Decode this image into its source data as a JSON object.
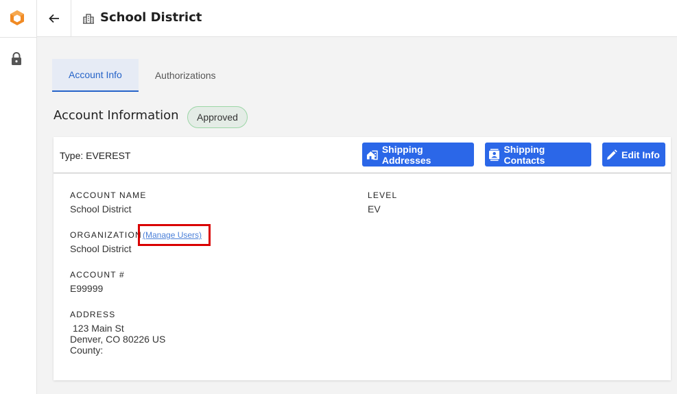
{
  "header": {
    "title": "School District"
  },
  "tabs": [
    {
      "label": "Account Info",
      "active": true
    },
    {
      "label": "Authorizations",
      "active": false
    }
  ],
  "section": {
    "title": "Account Information",
    "status": "Approved"
  },
  "card": {
    "type_label": "Type: EVEREST",
    "buttons": {
      "shipping_addresses": "Shipping Addresses",
      "shipping_contacts": "Shipping Contacts",
      "edit_info": "Edit Info"
    },
    "fields": {
      "account_name_label": "ACCOUNT NAME",
      "account_name_value": "School District",
      "level_label": "LEVEL",
      "level_value": "EV",
      "organization_label": "ORGANIZATION",
      "manage_users_link": "(Manage Users)",
      "organization_value": "School District",
      "account_number_label": "ACCOUNT #",
      "account_number_value": "E99999",
      "address_label": "ADDRESS",
      "address_line1": "123 Main St",
      "address_line2": "Denver, CO 80226 US",
      "address_line3": "County:"
    }
  },
  "colors": {
    "primary": "#2b67e8",
    "logo_orange": "#f08a24",
    "approved_bg": "#e4ece6",
    "approved_border": "#9bd6a6",
    "highlight": "#d90000"
  },
  "icons": {
    "logo": "cube-logo-icon",
    "lock": "lock-icon",
    "back": "arrow-left-icon",
    "building": "building-icon",
    "shipping_addresses": "house-icon",
    "shipping_contacts": "contact-card-icon",
    "edit": "pencil-icon"
  }
}
